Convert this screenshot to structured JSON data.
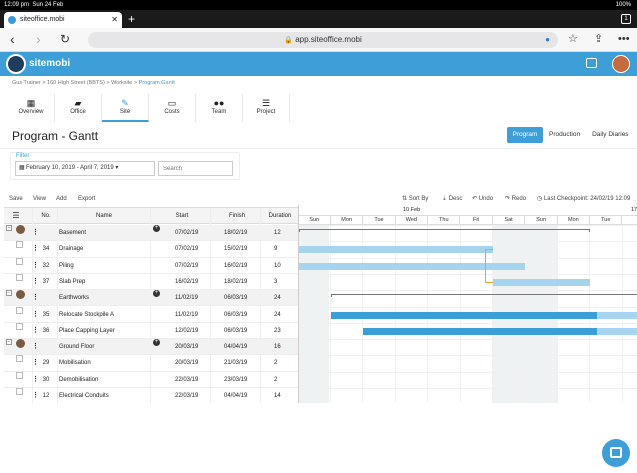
{
  "status_bar": {
    "time": "12:09 pm",
    "date": "Sun 24 Feb",
    "battery": "100%"
  },
  "browser": {
    "tab_title": "siteoffice.mobi",
    "tab_count": "1",
    "url": "app.siteoffice.mobi"
  },
  "app": {
    "logo_text": "sitemobi",
    "breadcrumb": [
      "Gus Trainer",
      "160 High Street (BBTS)",
      "Worksite",
      "Program Gantt"
    ],
    "nav": [
      {
        "label": "Overview",
        "icon": "calendar-icon"
      },
      {
        "label": "Office",
        "icon": "folder-icon"
      },
      {
        "label": "Site",
        "icon": "wrench-icon"
      },
      {
        "label": "Costs",
        "icon": "costs-icon"
      },
      {
        "label": "Team",
        "icon": "team-icon"
      },
      {
        "label": "Project",
        "icon": "sliders-icon"
      }
    ],
    "page_title": "Program - Gantt",
    "views": [
      "Program",
      "Production",
      "Daily Diaries"
    ],
    "filter": {
      "label": "Filter",
      "date_range": "February 10, 2019 - April 7, 2019",
      "search_placeholder": "Search"
    },
    "toolbar": {
      "save": "Save",
      "view": "View",
      "add": "Add",
      "export": "Export",
      "sort_by": "Sort By",
      "desc": "Desc",
      "undo": "Undo",
      "redo": "Redo",
      "last_checkpoint": "Last Checkpoint: 24/02/19 12:09"
    }
  },
  "grid": {
    "columns": [
      "No.",
      "Name",
      "Start",
      "Finish",
      "Duration"
    ],
    "rows": [
      {
        "no": "",
        "name": "Basement",
        "start": "07/02/19",
        "finish": "18/02/19",
        "duration": "12",
        "summary": true
      },
      {
        "no": "34",
        "name": "Drainage",
        "start": "07/02/19",
        "finish": "15/02/19",
        "duration": "9",
        "summary": false
      },
      {
        "no": "32",
        "name": "Piling",
        "start": "07/02/19",
        "finish": "16/02/19",
        "duration": "10",
        "summary": false
      },
      {
        "no": "37",
        "name": "Slab Prep",
        "start": "16/02/19",
        "finish": "18/02/19",
        "duration": "3",
        "summary": false
      },
      {
        "no": "",
        "name": "Earthworks",
        "start": "11/02/19",
        "finish": "06/03/19",
        "duration": "24",
        "summary": true
      },
      {
        "no": "35",
        "name": "Relocate Stockpile A",
        "start": "11/02/19",
        "finish": "06/03/19",
        "duration": "24",
        "summary": false
      },
      {
        "no": "36",
        "name": "Place Capping Layer",
        "start": "12/02/19",
        "finish": "06/03/19",
        "duration": "23",
        "summary": false
      },
      {
        "no": "",
        "name": "Ground Floor",
        "start": "20/03/19",
        "finish": "04/04/19",
        "duration": "16",
        "summary": true
      },
      {
        "no": "29",
        "name": "Mobilisation",
        "start": "20/03/19",
        "finish": "21/03/19",
        "duration": "2",
        "summary": false
      },
      {
        "no": "30",
        "name": "Demobilisation",
        "start": "22/03/19",
        "finish": "23/03/19",
        "duration": "2",
        "summary": false
      },
      {
        "no": "12",
        "name": "Electrical Conduits",
        "start": "22/03/19",
        "finish": "04/04/19",
        "duration": "14",
        "summary": false
      }
    ]
  },
  "gantt": {
    "week_labels": [
      "10 Feb",
      "17"
    ],
    "days": [
      "Sun",
      "Mon",
      "Tue",
      "Wed",
      "Thu",
      "Fri",
      "Sat",
      "Sun",
      "Mon",
      "Tue"
    ],
    "colors": {
      "bar": "#3a9fd6",
      "bar_light": "#a6d3ee",
      "weekend": "#eef2f3",
      "link": "#f0a030",
      "header": "#3e9ed8"
    }
  }
}
